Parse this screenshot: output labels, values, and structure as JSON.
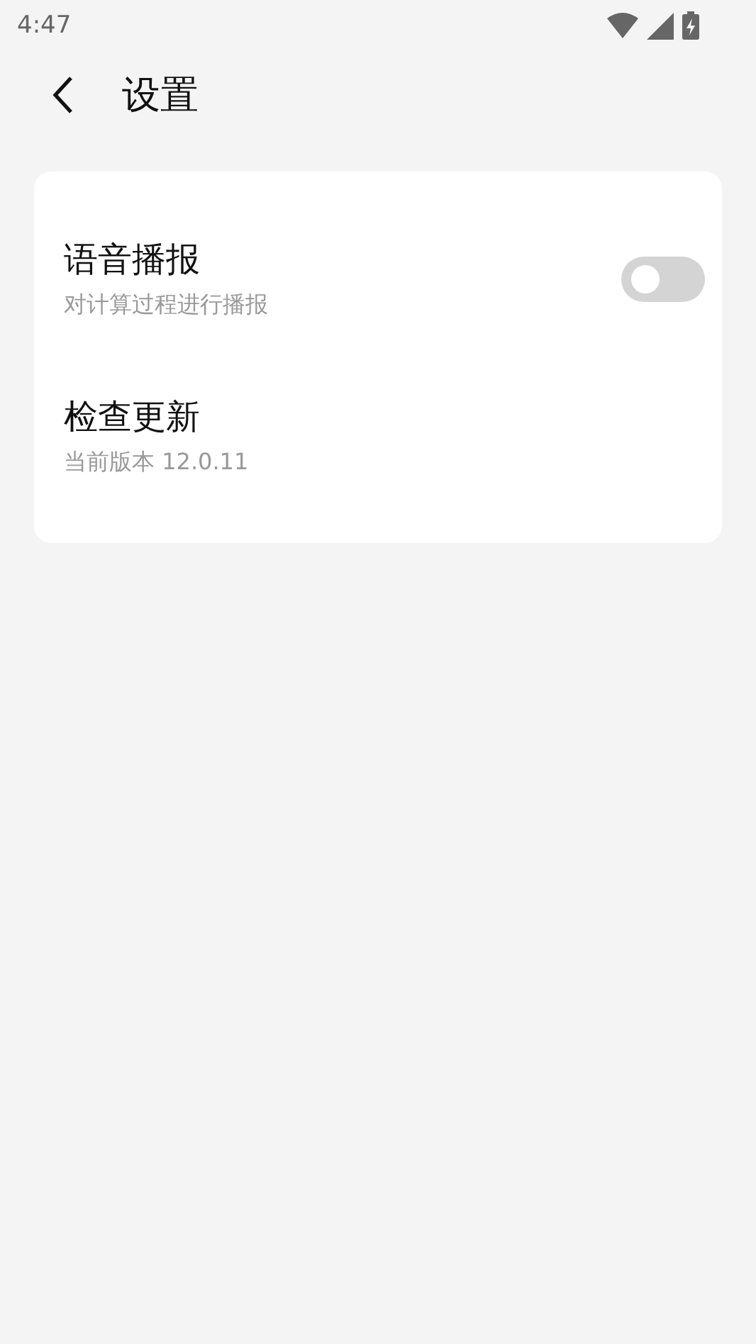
{
  "status_bar": {
    "time": "4:47"
  },
  "header": {
    "title": "设置"
  },
  "settings": [
    {
      "kind": "toggle",
      "title": "语音播报",
      "subtitle": "对计算过程进行播报",
      "on": false
    },
    {
      "kind": "plain",
      "title": "检查更新",
      "subtitle": "当前版本 12.0.11"
    }
  ]
}
